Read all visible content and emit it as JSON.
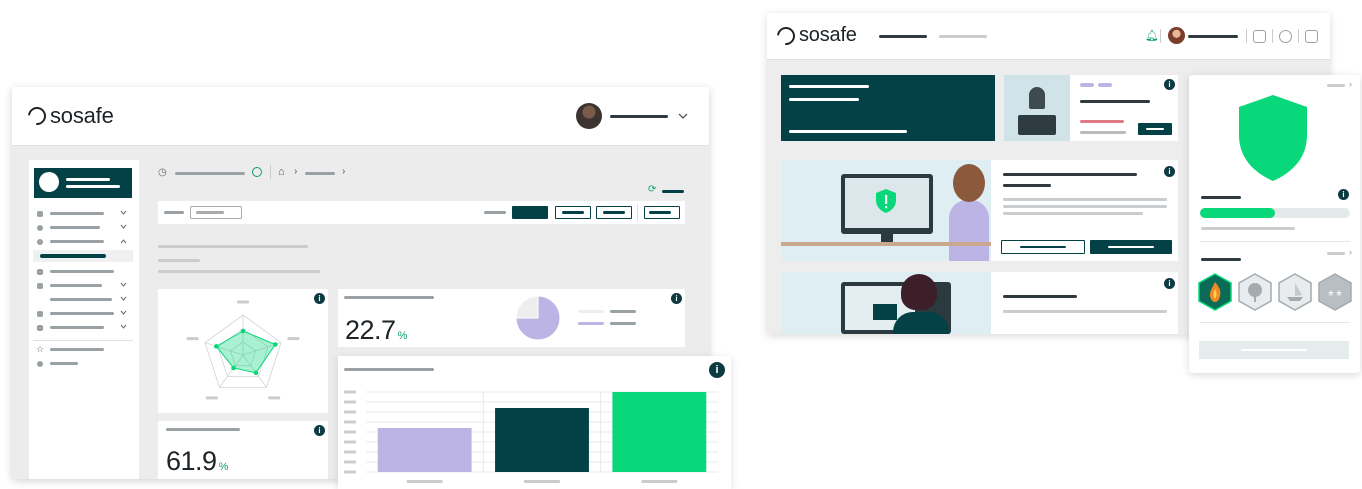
{
  "colors": {
    "brand_dark": "#034146",
    "brand_green": "#08d77a",
    "lavender": "#bdb4e6",
    "background": "#ececec"
  },
  "left_app": {
    "logo_text": "sosafe",
    "kpi_1": {
      "value": "22.7",
      "unit": "%"
    },
    "kpi_2": {
      "value": "61.9",
      "unit": "%"
    },
    "icons": {
      "header": [
        "avatar",
        "chevron-down-icon"
      ],
      "breadcrumb": [
        "clock-icon",
        "info-icon",
        "home-icon",
        "chevron-right-icon"
      ],
      "sidebar": [
        "document-icon",
        "gear-icon",
        "clock-icon",
        "rocket-icon",
        "users-icon",
        "layers-icon",
        "mail-icon",
        "star-icon",
        "help-icon"
      ],
      "refresh": "refresh-icon"
    }
  },
  "right_app": {
    "logo_text": "sosafe",
    "icons": [
      "bell-icon",
      "avatar",
      "thumbs-up-icon",
      "help-icon",
      "logout-icon"
    ],
    "shield_status": "shield-check-icon",
    "progress_fraction": 0.5,
    "badges": [
      "fire-badge-icon",
      "tree-badge-icon",
      "boat-badge-icon",
      "stars-badge-icon"
    ]
  },
  "chart_data": [
    {
      "type": "radar",
      "axes": [
        "",
        "",
        "",
        "",
        ""
      ],
      "values": [
        0.6,
        0.85,
        0.55,
        0.4,
        0.7
      ],
      "color": "#08d77a"
    },
    {
      "type": "pie",
      "slices": [
        {
          "label": "",
          "value": 75,
          "color": "#bdb4e6"
        },
        {
          "label": "",
          "value": 25,
          "color": "#eeeeee"
        }
      ]
    },
    {
      "type": "bar",
      "categories": [
        "",
        "",
        ""
      ],
      "values": [
        55,
        80,
        100
      ],
      "colors": [
        "#bdb4e6",
        "#034146",
        "#08d77a"
      ],
      "ylim": [
        0,
        100
      ]
    }
  ]
}
